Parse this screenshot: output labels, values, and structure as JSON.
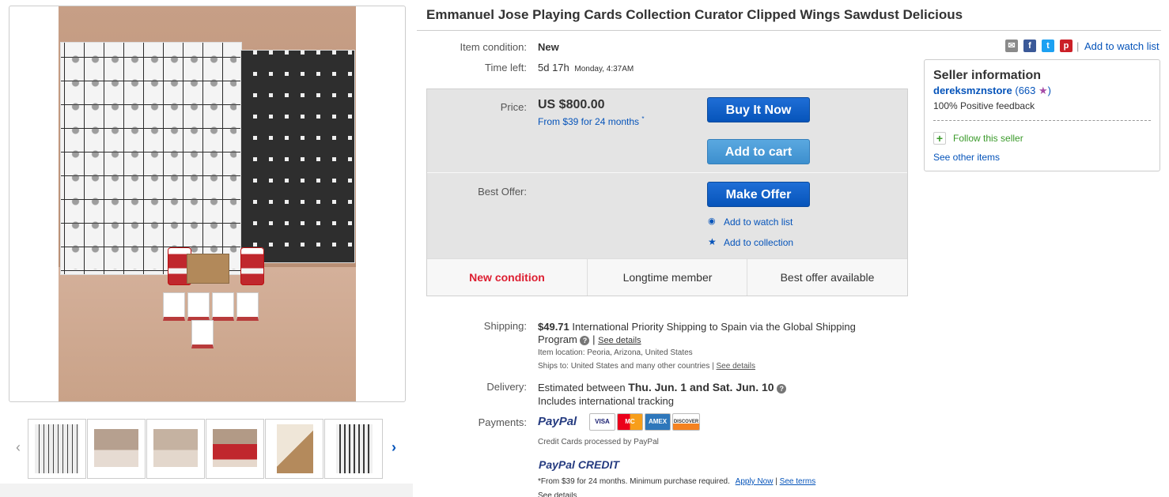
{
  "title": "Emmanuel Jose Playing Cards Collection Curator Clipped Wings Sawdust Delicious",
  "condition": {
    "label": "Item condition:",
    "value": "New"
  },
  "time_left": {
    "label": "Time left:",
    "value": "5d 17h",
    "ends": "Monday, 4:37AM"
  },
  "price": {
    "label": "Price:",
    "value": "US $800.00",
    "financing": "From $39 for 24 months",
    "financing_mark": "*"
  },
  "buttons": {
    "buy_now": "Buy It Now",
    "add_to_cart": "Add to cart",
    "make_offer": "Make Offer"
  },
  "best_offer": {
    "label": "Best Offer:"
  },
  "offer_links": {
    "watch": "Add to watch list",
    "collection": "Add to collection"
  },
  "features": [
    "New condition",
    "Longtime member",
    "Best offer available"
  ],
  "features_accent": "#dd1e31",
  "share": {
    "icons": [
      "email-icon",
      "facebook-icon",
      "twitter-icon",
      "pinterest-icon"
    ],
    "separator": "|",
    "watch_link": "Add to watch list"
  },
  "seller": {
    "heading": "Seller information",
    "name": "dereksmznstore",
    "feedback_open": "(",
    "feedback_score": "663",
    "feedback_close": ")",
    "positive": "100% Positive feedback",
    "follow": "Follow this seller",
    "other_items": "See other items"
  },
  "shipping": {
    "label": "Shipping:",
    "cost": "$49.71",
    "service": "International Priority Shipping to Spain  via the Global Shipping",
    "program": "Program",
    "separator": "|",
    "details": "See details",
    "location_label": "Item location:",
    "location": "Peoria, Arizona, United States",
    "ships_label": "Ships to:",
    "ships_to": "United States and many other countries |",
    "ships_details": "See details"
  },
  "delivery": {
    "label": "Delivery:",
    "prefix": "Estimated between",
    "dates": "Thu. Jun. 1 and Sat. Jun. 10",
    "tracking": "Includes international tracking"
  },
  "payments": {
    "label": "Payments:",
    "paypal": "PayPal",
    "cards": [
      "VISA",
      "MC",
      "AMEX",
      "DISCOVER"
    ],
    "processed": "Credit Cards processed by PayPal",
    "credit_brand": "PayPal CREDIT",
    "credit_terms": "*From $39 for 24 months. Minimum purchase required.",
    "apply": "Apply Now",
    "terms_sep": "|",
    "see_terms": "See terms",
    "see_details_cut": "See details"
  },
  "colors": {
    "link": "#0654ba",
    "buy_button": "#0654ba",
    "cart_button": "#3d8fce",
    "paypal_dark": "#253b80",
    "paypal_light": "#179bd7"
  }
}
